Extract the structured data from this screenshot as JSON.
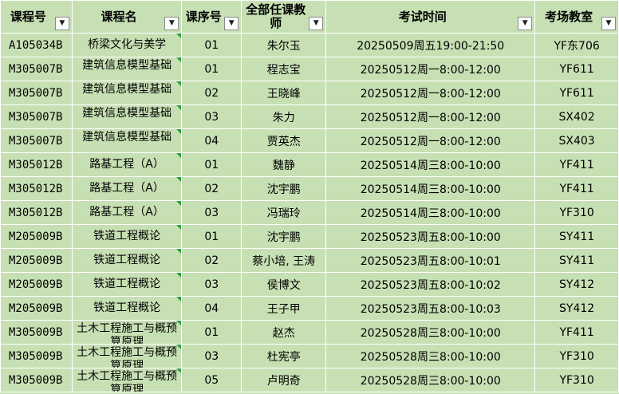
{
  "headers": [
    "课程号",
    "课程名",
    "课序号",
    "全部任课教师",
    "考试时间",
    "考场教室"
  ],
  "filter_icon": "▼",
  "rows": [
    {
      "code": "A105034B",
      "name": "桥梁文化与美学",
      "seq": "01",
      "teacher": "朱尔玉",
      "time": "20250509周五19:00-21:50",
      "room": "YF东706"
    },
    {
      "code": "M305007B",
      "name": "建筑信息模型基础",
      "seq": "01",
      "teacher": "程志宝",
      "time": "20250512周一8:00-12:00",
      "room": "YF611"
    },
    {
      "code": "M305007B",
      "name": "建筑信息模型基础",
      "seq": "02",
      "teacher": "王晓峰",
      "time": "20250512周一8:00-12:00",
      "room": "YF611"
    },
    {
      "code": "M305007B",
      "name": "建筑信息模型基础",
      "seq": "03",
      "teacher": "朱力",
      "time": "20250512周一8:00-12:00",
      "room": "SX402"
    },
    {
      "code": "M305007B",
      "name": "建筑信息模型基础",
      "seq": "04",
      "teacher": "贾英杰",
      "time": "20250512周一8:00-12:00",
      "room": "SX403"
    },
    {
      "code": "M305012B",
      "name": "路基工程（A）",
      "seq": "01",
      "teacher": "魏静",
      "time": "20250514周三8:00-10:00",
      "room": "YF411"
    },
    {
      "code": "M305012B",
      "name": "路基工程（A）",
      "seq": "02",
      "teacher": "沈宇鹏",
      "time": "20250514周三8:00-10:00",
      "room": "YF411"
    },
    {
      "code": "M305012B",
      "name": "路基工程（A）",
      "seq": "03",
      "teacher": "冯瑞玲",
      "time": "20250514周三8:00-10:00",
      "room": "YF310"
    },
    {
      "code": "M205009B",
      "name": "铁道工程概论",
      "seq": "01",
      "teacher": "沈宇鹏",
      "time": "20250523周五8:00-10:00",
      "room": "SY411"
    },
    {
      "code": "M205009B",
      "name": "铁道工程概论",
      "seq": "02",
      "teacher": "蔡小培, 王涛",
      "time": "20250523周五8:00-10:01",
      "room": "SY411"
    },
    {
      "code": "M205009B",
      "name": "铁道工程概论",
      "seq": "03",
      "teacher": "侯博文",
      "time": "20250523周五8:00-10:02",
      "room": "SY412"
    },
    {
      "code": "M205009B",
      "name": "铁道工程概论",
      "seq": "04",
      "teacher": "王子甲",
      "time": "20250523周五8:00-10:03",
      "room": "SY412"
    },
    {
      "code": "M305009B",
      "name": "土木工程施工与概预算原理",
      "seq": "01",
      "teacher": "赵杰",
      "time": "20250528周三8:00-10:00",
      "room": "YF411"
    },
    {
      "code": "M305009B",
      "name": "土木工程施工与概预算原理",
      "seq": "03",
      "teacher": "杜宪亭",
      "time": "20250528周三8:00-10:00",
      "room": "YF310"
    },
    {
      "code": "M305009B",
      "name": "土木工程施工与概预算原理",
      "seq": "05",
      "teacher": "卢明奇",
      "time": "20250528周三8:00-10:00",
      "room": "YF310"
    }
  ],
  "colors": {
    "cell_bg": "#c6e0b4",
    "grid": "#ffffff",
    "comment_marker": "#2e9e3f"
  }
}
